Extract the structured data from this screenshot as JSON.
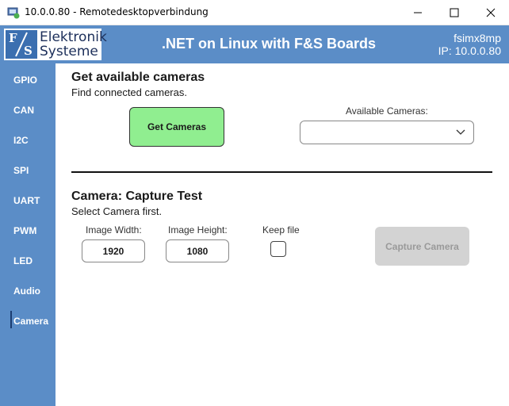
{
  "window": {
    "title": "10.0.0.80 - Remotedesktopverbindung",
    "minimize_icon": "minimize-icon",
    "maximize_icon": "maximize-icon",
    "close_icon": "close-icon"
  },
  "header": {
    "logo_line1": "Elektronik",
    "logo_line2": "Systeme",
    "logo_mark": "F S",
    "title": ".NET on Linux with F&S Boards",
    "device": "fsimx8mp",
    "ip": "IP: 10.0.0.80",
    "colors": {
      "header_bg": "#5b8dc7",
      "sidebar_bg": "#5b8dc7"
    }
  },
  "sidebar": {
    "items": [
      {
        "label": "GPIO"
      },
      {
        "label": "CAN"
      },
      {
        "label": "I2C"
      },
      {
        "label": "SPI"
      },
      {
        "label": "UART"
      },
      {
        "label": "PWM"
      },
      {
        "label": "LED"
      },
      {
        "label": "Audio"
      },
      {
        "label": "Camera"
      }
    ],
    "active": "Camera"
  },
  "cameras": {
    "title": "Get available cameras",
    "subtitle": "Find connected cameras.",
    "button_label": "Get Cameras",
    "button_color": "#90ee90",
    "dropdown_label": "Available Cameras:",
    "dropdown_value": ""
  },
  "capture": {
    "title": "Camera: Capture Test",
    "subtitle": "Select Camera first.",
    "width_label": "Image Width:",
    "width_value": "1920",
    "height_label": "Image Height:",
    "height_value": "1080",
    "keep_label": "Keep file",
    "keep_checked": false,
    "button_label": "Capture Camera",
    "button_enabled": false
  }
}
